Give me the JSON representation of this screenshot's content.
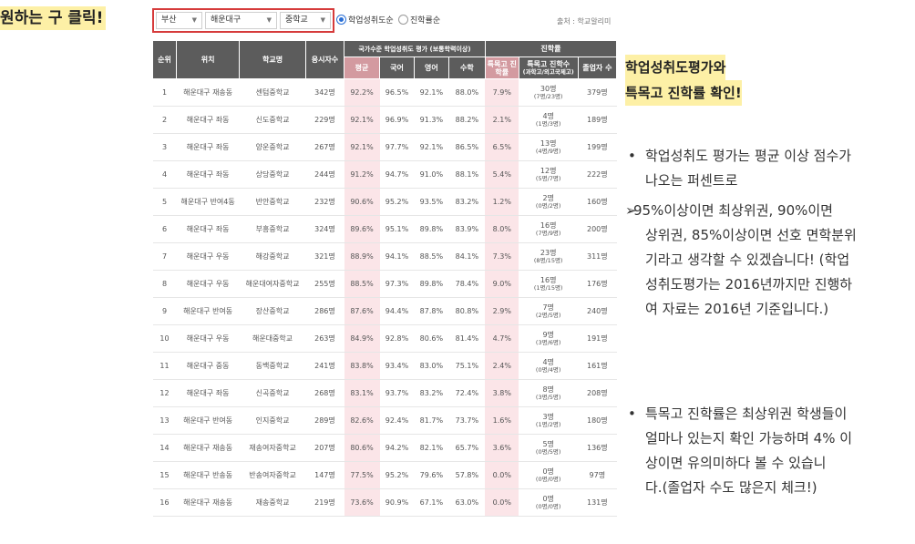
{
  "annotation": {
    "left_title": "원하는 구 클릭!",
    "right_title_line1": "학업성취도평가와",
    "right_title_line2": "특목고 진학률 확인!",
    "bullet1_lines": [
      "학업성취도 평가는 평균 이상 점수가",
      "나오는 퍼센트로"
    ],
    "arrow_lines": [
      "95%이상이면 최상위권, 90%이면",
      "상위권, 85%이상이면 선호 면학분위",
      "기라고 생각할 수 있겠습니다! (학업",
      "성취도평가는 2016년까지만 진행하",
      "여 자료는 2016년 기준입니다.)"
    ],
    "bullet2_lines": [
      "특목고 진학률은 최상위권 학생들이",
      "얼마나 있는지 확인 가능하며 4% 이",
      "상이면 유의미하다 볼 수 있습니",
      "다.(졸업자 수도 많은지 체크!)"
    ],
    "bullet_symbol": "•",
    "arrow_symbol": "➢"
  },
  "filters": {
    "city": "부산",
    "district": "해운대구",
    "school_type": "중학교",
    "arrow": "▼",
    "radio1": "학업성취도순",
    "radio2": "진학률순",
    "source": "출처 : 학교알리미"
  },
  "headers": {
    "rank": "순위",
    "location": "위치",
    "school": "학교명",
    "examinees": "응시자수",
    "national": "국가수준 학업성취도 평가 (보통학력이상)",
    "avg": "평균",
    "korean": "국어",
    "english": "영어",
    "math": "수학",
    "advancement": "진학률",
    "special_rate": "특목고 진학률",
    "special_count": "특목고 진학수",
    "special_count_sub": "(과학고/외고국제고)",
    "graduates": "졸업자 수"
  },
  "rows": [
    {
      "rank": "1",
      "loc": "해운대구 재송동",
      "school": "센텀중학교",
      "n": "342명",
      "avg": "92.2%",
      "kor": "96.5%",
      "eng": "92.1%",
      "math": "88.0%",
      "rate": "7.9%",
      "cnt": "30명",
      "cnt_sub": "(7명/23명)",
      "grad": "379명"
    },
    {
      "rank": "2",
      "loc": "해운대구 좌동",
      "school": "신도중학교",
      "n": "229명",
      "avg": "92.1%",
      "kor": "96.9%",
      "eng": "91.3%",
      "math": "88.2%",
      "rate": "2.1%",
      "cnt": "4명",
      "cnt_sub": "(1명/3명)",
      "grad": "189명"
    },
    {
      "rank": "3",
      "loc": "해운대구 좌동",
      "school": "양운중학교",
      "n": "267명",
      "avg": "92.1%",
      "kor": "97.7%",
      "eng": "92.1%",
      "math": "86.5%",
      "rate": "6.5%",
      "cnt": "13명",
      "cnt_sub": "(4명/9명)",
      "grad": "199명"
    },
    {
      "rank": "4",
      "loc": "해운대구 좌동",
      "school": "상당중학교",
      "n": "244명",
      "avg": "91.2%",
      "kor": "94.7%",
      "eng": "91.0%",
      "math": "88.1%",
      "rate": "5.4%",
      "cnt": "12명",
      "cnt_sub": "(5명/7명)",
      "grad": "222명"
    },
    {
      "rank": "5",
      "loc": "해운대구 반여4동",
      "school": "반안중학교",
      "n": "232명",
      "avg": "90.6%",
      "kor": "95.2%",
      "eng": "93.5%",
      "math": "83.2%",
      "rate": "1.2%",
      "cnt": "2명",
      "cnt_sub": "(0명/2명)",
      "grad": "160명"
    },
    {
      "rank": "6",
      "loc": "해운대구 좌동",
      "school": "부흥중학교",
      "n": "324명",
      "avg": "89.6%",
      "kor": "95.1%",
      "eng": "89.8%",
      "math": "83.9%",
      "rate": "8.0%",
      "cnt": "16명",
      "cnt_sub": "(7명/9명)",
      "grad": "200명"
    },
    {
      "rank": "7",
      "loc": "해운대구 우동",
      "school": "해강중학교",
      "n": "321명",
      "avg": "88.9%",
      "kor": "94.1%",
      "eng": "88.5%",
      "math": "84.1%",
      "rate": "7.3%",
      "cnt": "23명",
      "cnt_sub": "(8명/15명)",
      "grad": "311명"
    },
    {
      "rank": "8",
      "loc": "해운대구 우동",
      "school": "해운대여자중학교",
      "n": "255명",
      "avg": "88.5%",
      "kor": "97.3%",
      "eng": "89.8%",
      "math": "78.4%",
      "rate": "9.0%",
      "cnt": "16명",
      "cnt_sub": "(1명/15명)",
      "grad": "176명"
    },
    {
      "rank": "9",
      "loc": "해운대구 반여동",
      "school": "장산중학교",
      "n": "286명",
      "avg": "87.6%",
      "kor": "94.4%",
      "eng": "87.8%",
      "math": "80.8%",
      "rate": "2.9%",
      "cnt": "7명",
      "cnt_sub": "(2명/5명)",
      "grad": "240명"
    },
    {
      "rank": "10",
      "loc": "해운대구 우동",
      "school": "해운대중학교",
      "n": "263명",
      "avg": "84.9%",
      "kor": "92.8%",
      "eng": "80.6%",
      "math": "81.4%",
      "rate": "4.7%",
      "cnt": "9명",
      "cnt_sub": "(3명/6명)",
      "grad": "191명"
    },
    {
      "rank": "11",
      "loc": "해운대구 중동",
      "school": "동백중학교",
      "n": "241명",
      "avg": "83.8%",
      "kor": "93.4%",
      "eng": "83.0%",
      "math": "75.1%",
      "rate": "2.4%",
      "cnt": "4명",
      "cnt_sub": "(0명/4명)",
      "grad": "161명"
    },
    {
      "rank": "12",
      "loc": "해운대구 좌동",
      "school": "신곡중학교",
      "n": "268명",
      "avg": "83.1%",
      "kor": "93.7%",
      "eng": "83.2%",
      "math": "72.4%",
      "rate": "3.8%",
      "cnt": "8명",
      "cnt_sub": "(3명/5명)",
      "grad": "208명"
    },
    {
      "rank": "13",
      "loc": "해운대구 반여동",
      "school": "인지중학교",
      "n": "289명",
      "avg": "82.6%",
      "kor": "92.4%",
      "eng": "81.7%",
      "math": "73.7%",
      "rate": "1.6%",
      "cnt": "3명",
      "cnt_sub": "(1명/2명)",
      "grad": "180명"
    },
    {
      "rank": "14",
      "loc": "해운대구 재송동",
      "school": "재송여자중학교",
      "n": "207명",
      "avg": "80.6%",
      "kor": "94.2%",
      "eng": "82.1%",
      "math": "65.7%",
      "rate": "3.6%",
      "cnt": "5명",
      "cnt_sub": "(0명/5명)",
      "grad": "136명"
    },
    {
      "rank": "15",
      "loc": "해운대구 반송동",
      "school": "반송여자중학교",
      "n": "147명",
      "avg": "77.5%",
      "kor": "95.2%",
      "eng": "79.6%",
      "math": "57.8%",
      "rate": "0.0%",
      "cnt": "0명",
      "cnt_sub": "(0명/0명)",
      "grad": "97명"
    },
    {
      "rank": "16",
      "loc": "해운대구 재송동",
      "school": "재송중학교",
      "n": "219명",
      "avg": "73.6%",
      "kor": "90.9%",
      "eng": "67.1%",
      "math": "63.0%",
      "rate": "0.0%",
      "cnt": "0명",
      "cnt_sub": "(0명/0명)",
      "grad": "131명"
    }
  ],
  "colors": {
    "filter_border": "#d63b3b",
    "header_bg": "#5c5c5c",
    "pink_header": "#d39aa0",
    "pink_cell": "#fbe5e8",
    "highlight": "#fdf0a6"
  }
}
